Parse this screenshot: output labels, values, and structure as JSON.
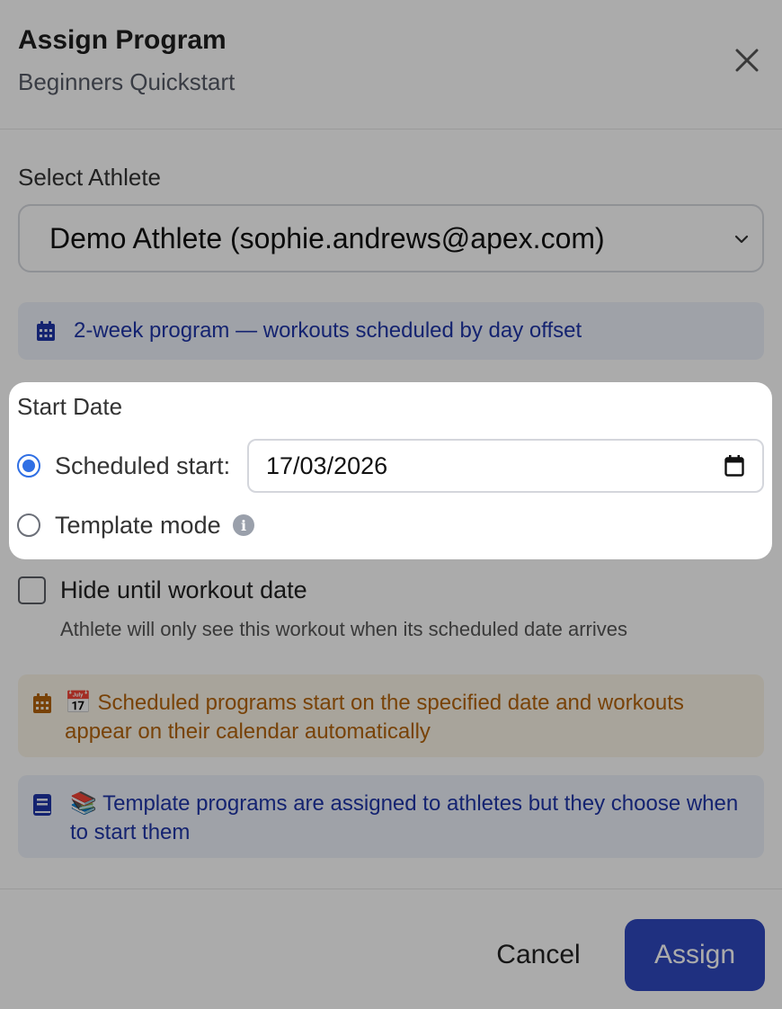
{
  "dialog": {
    "title": "Assign Program",
    "subtitle": "Beginners Quickstart",
    "close_icon": "close-icon"
  },
  "athlete": {
    "label": "Select Athlete",
    "selected": "Demo Athlete (sophie.andrews@apex.com)"
  },
  "program_info": {
    "icon": "calendar-icon",
    "text": "2-week program — workouts scheduled by day offset"
  },
  "start_date": {
    "label": "Start Date",
    "options": [
      {
        "label": "Scheduled start:",
        "checked": true
      },
      {
        "label": "Template mode",
        "checked": false
      }
    ],
    "date_value": "17/03/2026",
    "info_icon": "info-icon"
  },
  "hide_option": {
    "label": "Hide until workout date",
    "checked": false,
    "help": "Athlete will only see this workout when its scheduled date arrives"
  },
  "notes": {
    "scheduled": "📅 Scheduled programs start on the specified date and workouts appear on their calendar automatically",
    "template": "📚 Template programs are assigned to athletes but they choose when to start them"
  },
  "footer": {
    "cancel": "Cancel",
    "assign": "Assign"
  },
  "colors": {
    "accent": "#2f6fe4",
    "primary_button": "#2f48bf",
    "info_text": "#1f35a8",
    "warning_text": "#b4630b"
  }
}
